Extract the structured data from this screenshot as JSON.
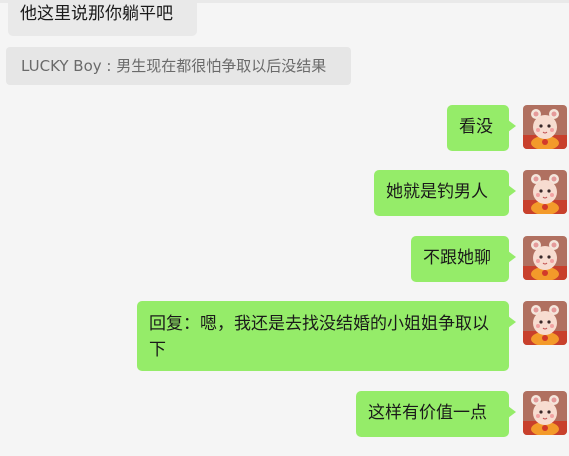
{
  "chat": {
    "incoming": [
      {
        "text": "他这里说那你躺平吧"
      }
    ],
    "quote": {
      "text": "LUCKY Boy : 男生现在都很怕争取以后没结果"
    },
    "outgoing": [
      {
        "text": "看没"
      },
      {
        "text": "她就是钓男人"
      },
      {
        "text": "不跟她聊"
      },
      {
        "text": "回复：嗯，我还是去找没结婚的小姐姐争取以下"
      },
      {
        "text": "这样有价值一点"
      }
    ],
    "self_avatar_icon": "self-avatar-icon",
    "colors": {
      "background": "#f5f5f5",
      "outgoing_bubble": "#95ec69",
      "incoming_bubble": "#e9e9e9",
      "quote_bubble": "#e6e6e6"
    }
  }
}
